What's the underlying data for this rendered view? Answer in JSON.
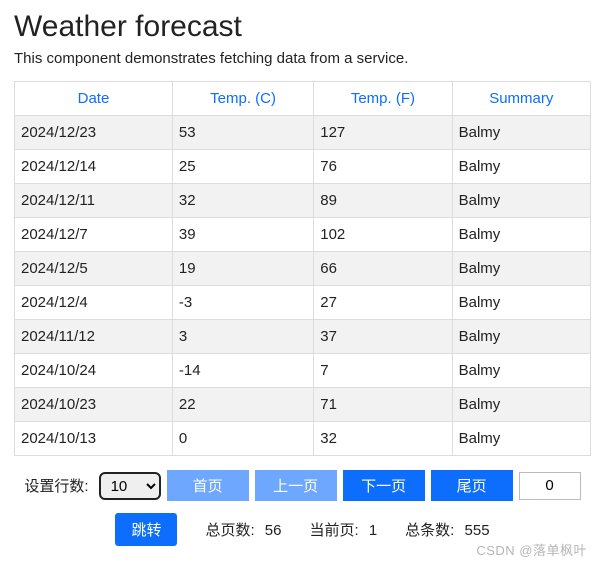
{
  "title": "Weather forecast",
  "subtitle": "This component demonstrates fetching data from a service.",
  "table": {
    "headers": [
      "Date",
      "Temp. (C)",
      "Temp. (F)",
      "Summary"
    ],
    "rows": [
      {
        "date": "2024/12/23",
        "c": "53",
        "f": "127",
        "summary": "Balmy"
      },
      {
        "date": "2024/12/14",
        "c": "25",
        "f": "76",
        "summary": "Balmy"
      },
      {
        "date": "2024/12/11",
        "c": "32",
        "f": "89",
        "summary": "Balmy"
      },
      {
        "date": "2024/12/7",
        "c": "39",
        "f": "102",
        "summary": "Balmy"
      },
      {
        "date": "2024/12/5",
        "c": "19",
        "f": "66",
        "summary": "Balmy"
      },
      {
        "date": "2024/12/4",
        "c": "-3",
        "f": "27",
        "summary": "Balmy"
      },
      {
        "date": "2024/11/12",
        "c": "3",
        "f": "37",
        "summary": "Balmy"
      },
      {
        "date": "2024/10/24",
        "c": "-14",
        "f": "7",
        "summary": "Balmy"
      },
      {
        "date": "2024/10/23",
        "c": "22",
        "f": "71",
        "summary": "Balmy"
      },
      {
        "date": "2024/10/13",
        "c": "0",
        "f": "32",
        "summary": "Balmy"
      }
    ]
  },
  "pager": {
    "setRowsLabel": "设置行数:",
    "rowsValue": "10",
    "first": "首页",
    "prev": "上一页",
    "next": "下一页",
    "last": "尾页",
    "pageInput": "0",
    "jumpLabel": "跳转",
    "totalPagesLabel": "总页数:",
    "totalPages": "56",
    "currentPageLabel": "当前页:",
    "currentPage": "1",
    "totalItemsLabel": "总条数:",
    "totalItems": "555"
  },
  "watermark": "CSDN @落单枫叶"
}
